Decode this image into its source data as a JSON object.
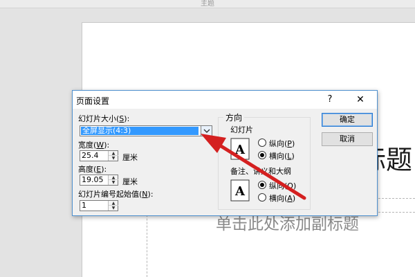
{
  "window": {
    "title": "主题"
  },
  "slide": {
    "title": "标题",
    "subtitle": "单击此处添加副标题"
  },
  "dialog": {
    "title": "页面设置",
    "help_glyph": "?",
    "close_glyph": "✕",
    "slide_size": {
      "label_prefix": "幻灯片大小(",
      "accel": "S",
      "label_suffix": "):",
      "value": "全屏显示(4:3)"
    },
    "width": {
      "label_prefix": "宽度(",
      "accel": "W",
      "label_suffix": "):",
      "value": "25.4",
      "unit": "厘米"
    },
    "height": {
      "label_prefix": "高度(",
      "accel": "E",
      "label_suffix": "):",
      "value": "19.05",
      "unit": "厘米"
    },
    "start_number": {
      "label_prefix": "幻灯片编号起始值(",
      "accel": "N",
      "label_suffix": "):",
      "value": "1"
    },
    "orientation": {
      "title": "方向",
      "slides": {
        "label": "幻灯片",
        "portrait_prefix": "纵向(",
        "portrait_accel": "P",
        "portrait_suffix": ")",
        "landscape_prefix": "横向(",
        "landscape_accel": "L",
        "landscape_suffix": ")",
        "selected": "landscape"
      },
      "notes": {
        "label": "备注、讲义和大纲",
        "portrait_prefix": "纵向(",
        "portrait_accel": "O",
        "portrait_suffix": ")",
        "landscape_prefix": "横向(",
        "landscape_accel": "A",
        "landscape_suffix": ")",
        "selected": "portrait"
      }
    },
    "ok_label": "确定",
    "cancel_label": "取消"
  },
  "annotation": {
    "arrow_color": "#d42020"
  },
  "icons": [
    "chevron-down-icon",
    "close-icon",
    "help-icon",
    "page-letter-a-icon",
    "spin-up-icon",
    "spin-down-icon",
    "red-arrow"
  ],
  "colors": {
    "dialog_border": "#4d8fce",
    "selection": "#3399ff",
    "dialog_bg": "#f0f0f0"
  }
}
